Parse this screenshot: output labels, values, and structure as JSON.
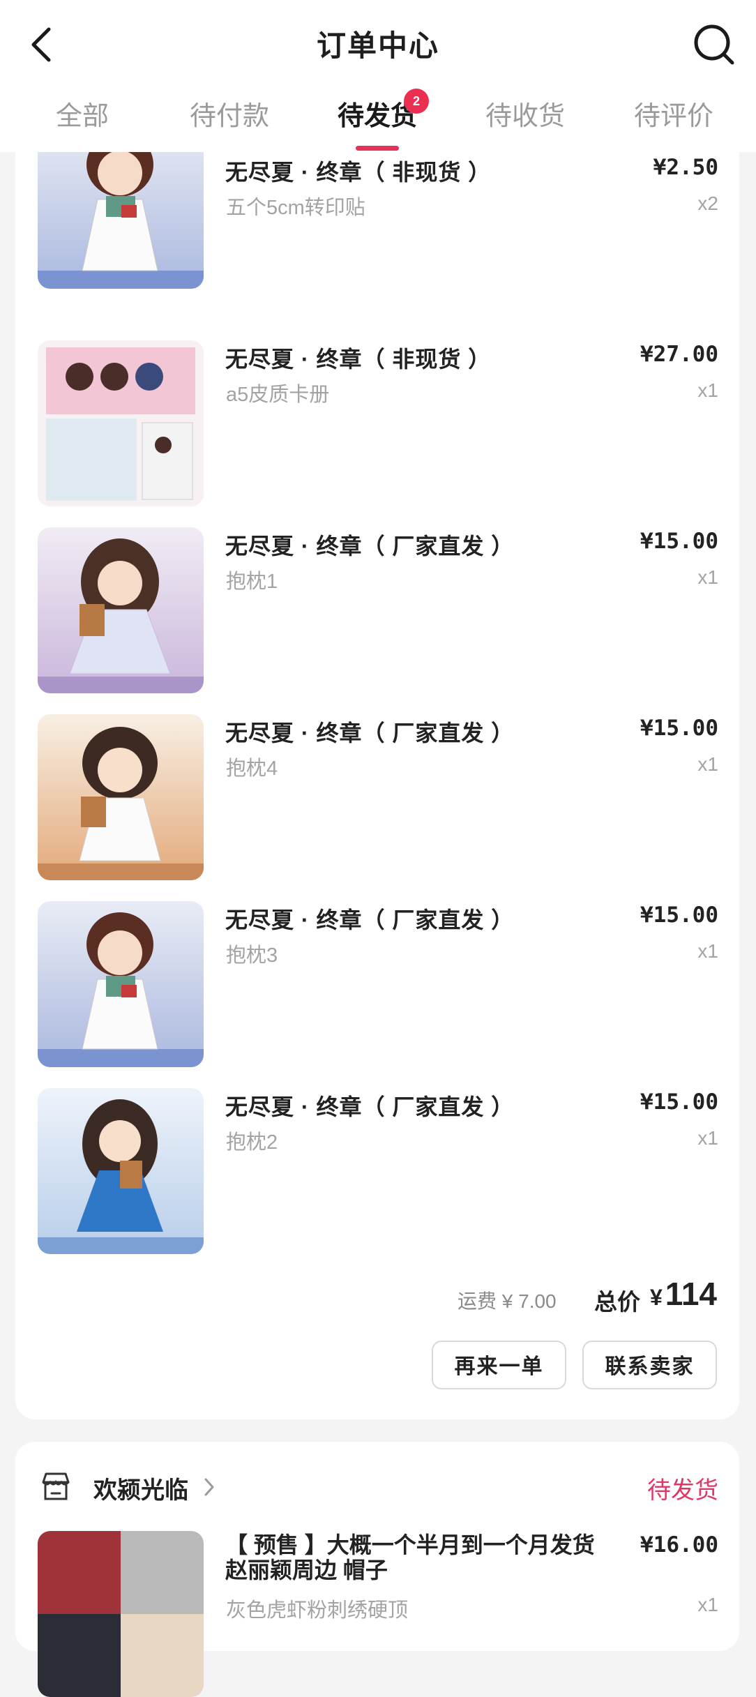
{
  "header": {
    "title": "订单中心",
    "tabs": [
      {
        "label": "全部"
      },
      {
        "label": "待付款"
      },
      {
        "label": "待发货",
        "badge": "2"
      },
      {
        "label": "待收货"
      },
      {
        "label": "待评价"
      }
    ],
    "active_tab": "待发货"
  },
  "order": {
    "items": [
      {
        "name": "无尽夏 · 终章（ 非现货 ）",
        "spec": "五个5cm转印贴",
        "price": "¥2.50",
        "qty": "x2"
      },
      {
        "name": "无尽夏 · 终章（ 非现货 ）",
        "spec": "a5皮质卡册",
        "price": "¥27.00",
        "qty": "x1"
      },
      {
        "name": "无尽夏 · 终章（ 厂家直发 ）",
        "spec": "抱枕1",
        "price": "¥15.00",
        "qty": "x1"
      },
      {
        "name": "无尽夏 · 终章（ 厂家直发 ）",
        "spec": "抱枕4",
        "price": "¥15.00",
        "qty": "x1"
      },
      {
        "name": "无尽夏 · 终章（ 厂家直发 ）",
        "spec": "抱枕3",
        "price": "¥15.00",
        "qty": "x1"
      },
      {
        "name": "无尽夏 · 终章（ 厂家直发 ）",
        "spec": "抱枕2",
        "price": "¥15.00",
        "qty": "x1"
      }
    ],
    "shipping": "运费 ¥ 7.00",
    "total_label": "总价",
    "total_currency": "¥",
    "total_value": "114",
    "buttons": {
      "reorder": "再来一单",
      "contact": "联系卖家"
    }
  },
  "order2": {
    "store_name": "欢颍光临",
    "status": "待发货",
    "item": {
      "name": "【 预售 】大概一个半月到一个月发货赵丽颖周边 帽子",
      "spec": "灰色虎虾粉刺绣硬顶",
      "price": "¥16.00",
      "qty": "x1"
    }
  },
  "colors": {
    "accent": "#e8315a",
    "status": "#e23766",
    "muted": "#a3a3a3"
  }
}
